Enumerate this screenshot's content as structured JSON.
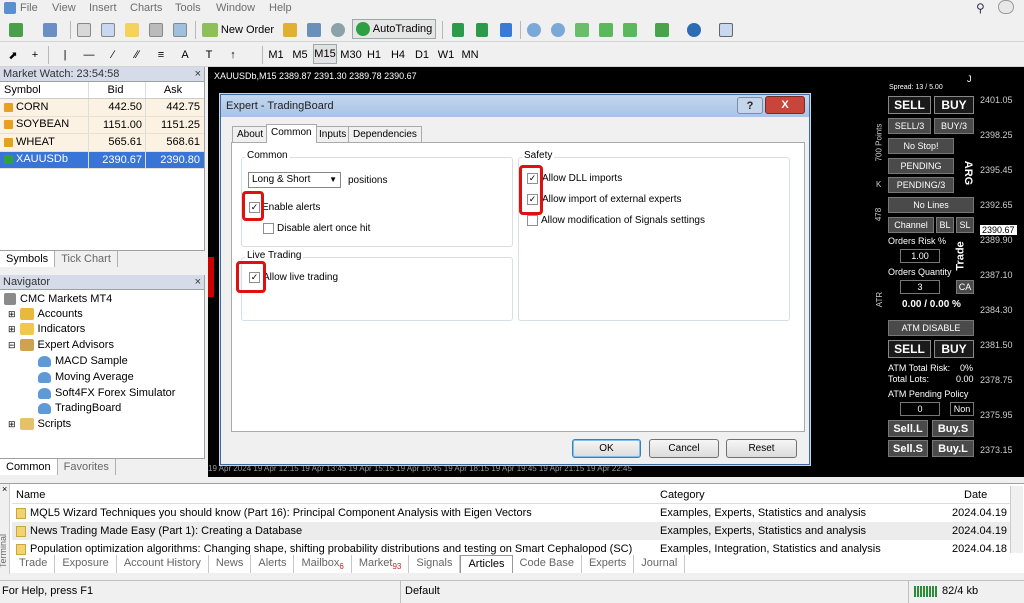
{
  "menu": [
    "File",
    "View",
    "Insert",
    "Charts",
    "Tools",
    "Window",
    "Help"
  ],
  "toolbar": {
    "new_order": "New Order",
    "autotrading": "AutoTrading",
    "timeframes": [
      "M1",
      "M5",
      "M15",
      "M30",
      "H1",
      "H4",
      "D1",
      "W1",
      "MN"
    ]
  },
  "market_watch": {
    "title": "Market Watch: 23:54:58",
    "headers": [
      "Symbol",
      "Bid",
      "Ask"
    ],
    "rows": [
      {
        "symbol": "CORN",
        "bid": "442.50",
        "ask": "442.75"
      },
      {
        "symbol": "SOYBEAN",
        "bid": "1151.00",
        "ask": "1151.25"
      },
      {
        "symbol": "WHEAT",
        "bid": "565.61",
        "ask": "568.61"
      },
      {
        "symbol": "XAUUSDb",
        "bid": "2390.67",
        "ask": "2390.80"
      }
    ],
    "tabs": [
      "Symbols",
      "Tick Chart"
    ]
  },
  "navigator": {
    "title": "Navigator",
    "root": "CMC Markets MT4",
    "items": [
      "Accounts",
      "Indicators",
      "Expert Advisors",
      "MACD Sample",
      "Moving Average",
      "Soft4FX Forex Simulator",
      "TradingBoard",
      "Scripts"
    ],
    "tabs": [
      "Common",
      "Favorites"
    ]
  },
  "chart": {
    "header": "XAUUSDb,M15  2389.87 2391.30 2389.78 2390.67",
    "prices": [
      "2401.05",
      "2398.25",
      "2395.45",
      "2392.65",
      "2389.90",
      "2387.10",
      "2384.30",
      "2381.50",
      "2378.75",
      "2375.95",
      "2373.15"
    ],
    "current_price": "2390.67",
    "dates": "19 Apr 2024   19 Apr 12:15   19 Apr 13:45   19 Apr 15:15   19 Apr 16:45   19 Apr 18:15   19 Apr 19:45   19 Apr 21:15   19 Apr 22:45"
  },
  "dialog": {
    "title": "Expert - TradingBoard",
    "help": "?",
    "close": "X",
    "tabs": [
      "About",
      "Common",
      "Inputs",
      "Dependencies"
    ],
    "common_group": "Common",
    "positions_select": "Long & Short",
    "positions_label": "positions",
    "enable_alerts": "Enable alerts",
    "disable_alert": "Disable alert once hit",
    "live_group": "Live Trading",
    "allow_live": "Allow live trading",
    "safety_group": "Safety",
    "allow_dll": "Allow DLL imports",
    "allow_external": "Allow import of external experts",
    "allow_signals": "Allow modification of Signals settings",
    "ok": "OK",
    "cancel": "Cancel",
    "reset": "Reset"
  },
  "right_panel": {
    "spread": "Spread: 13 / 5.00",
    "j": "J",
    "sell": "SELL",
    "buy": "BUY",
    "sell3": "SELL/3",
    "buy3": "BUY/3",
    "nostop": "No Stop!",
    "pending": "PENDING",
    "pending3": "PENDING/3",
    "nolines": "No Lines",
    "channel": "Channel",
    "bl": "BL",
    "sl": "SL",
    "arg": "ARG",
    "trade": "Trade",
    "orders_risk": "Orders Risk %",
    "risk_val": "1.00",
    "orders_qty": "Orders Quantity",
    "qty_val": "3",
    "ca": "CA",
    "pct": "0.00 / 0.00 %",
    "atm_disable": "ATM DISABLE",
    "sell2": "SELL",
    "buy2": "BUY",
    "atm_total_risk": "ATM Total Risk:",
    "atm_risk_val": "0%",
    "total_lots": "Total Lots:",
    "total_lots_val": "0.00",
    "atm_pending": "ATM Pending Policy",
    "pend_val": "0",
    "non": "Non",
    "sell_l": "Sell.L",
    "buy_s": "Buy.S",
    "sell_s": "Sell.S",
    "buy_l": "Buy.L",
    "points": "700 Points",
    "k": "K",
    "n478": "478",
    "atr": "ATR"
  },
  "terminal": {
    "headers": [
      "Name",
      "Category",
      "Date"
    ],
    "rows": [
      {
        "name": "MQL5 Wizard Techniques you should know (Part 16): Principal Component Analysis with Eigen Vectors",
        "cat": "Examples, Experts, Statistics and analysis",
        "date": "2024.04.19"
      },
      {
        "name": "News Trading Made Easy (Part 1): Creating a Database",
        "cat": "Examples, Experts, Statistics and analysis",
        "date": "2024.04.19"
      },
      {
        "name": "Population optimization algorithms: Changing shape, shifting probability distributions and testing on Smart Cephalopod (SC)",
        "cat": "Examples, Integration, Statistics and analysis",
        "date": "2024.04.18"
      }
    ],
    "tabs": [
      "Trade",
      "Exposure",
      "Account History",
      "News",
      "Alerts",
      "Mailbox",
      "Market",
      "Signals",
      "Articles",
      "Code Base",
      "Experts",
      "Journal"
    ],
    "mailbox_count": "6",
    "market_count": "93",
    "side_label": "Terminal"
  },
  "status": {
    "help": "For Help, press F1",
    "profile": "Default",
    "traffic": "82/4 kb"
  }
}
